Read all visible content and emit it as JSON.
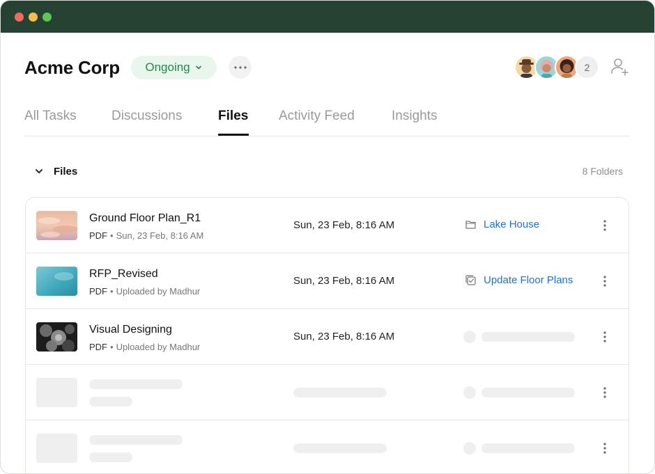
{
  "header": {
    "title": "Acme Corp",
    "status_label": "Ongoing",
    "member_overflow_count": "2"
  },
  "tabs": [
    {
      "label": "All Tasks",
      "active": false
    },
    {
      "label": "Discussions",
      "active": false
    },
    {
      "label": "Files",
      "active": true
    },
    {
      "label": "Activity Feed",
      "active": false
    },
    {
      "label": "Insights",
      "active": false
    }
  ],
  "section": {
    "title": "Files",
    "folder_count": "8 Folders"
  },
  "files": [
    {
      "name": "Ground Floor Plan_R1",
      "type": "PDF",
      "meta": "Sun, 23 Feb, 8:16 AM",
      "date": "Sun, 23 Feb, 8:16 AM",
      "link_label": "Lake House",
      "link_icon": "folder-icon"
    },
    {
      "name": "RFP_Revised",
      "type": "PDF",
      "meta": "Uploaded by Madhur",
      "date": "Sun, 23 Feb, 8:16 AM",
      "link_label": "Update Floor Plans",
      "link_icon": "task-checkbox-icon"
    },
    {
      "name": "Visual Designing",
      "type": "PDF",
      "meta": "Uploaded by Madhur",
      "date": "Sun, 23 Feb, 8:16 AM",
      "link_label": "",
      "link_icon": ""
    }
  ],
  "colors": {
    "titlebar": "#264232",
    "status_bg": "#e8f6ec",
    "status_text": "#1f8a4c",
    "link": "#1e6fd9"
  }
}
